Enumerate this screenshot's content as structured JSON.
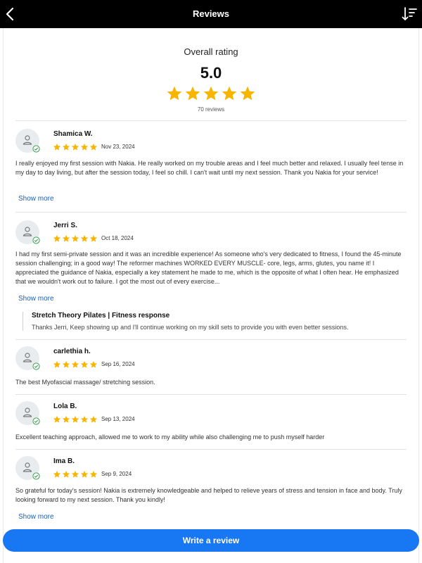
{
  "header": {
    "title": "Reviews",
    "back_icon": "chevron-left-icon",
    "sort_icon": "sort-descending-icon"
  },
  "overall": {
    "label": "Overall rating",
    "score": "5.0",
    "stars": 5,
    "count": "70 reviews"
  },
  "colors": {
    "star": "#f7b500",
    "accent": "#1877f2",
    "verified": "#2e9e44"
  },
  "reviews": [
    {
      "name": "Shamica W.",
      "rating": 5,
      "date": "Nov 23, 2024",
      "text": "I really enjoyed my first session with Nakia. He really worked on my trouble areas and I feel much better and relaxed. I usually feel tense in my day to day living, but after the session today, I feel so chill. I can't wait until my next session. Thank you Nakia for your service!",
      "more": "Show more"
    },
    {
      "name": "Jerri S.",
      "rating": 5,
      "date": "Oct 18, 2024",
      "text": "I had my first semi-private session and it was an incredible experience! As someone who's very dedicated to fitness, I found the 45-minute session challenging; in a good way! The reformer machines WORKED EVERY MUSCLE- core, legs, arms, glutes, you name it! I appreciated the guidance of Nakia, especially a key statement he made to me, which is the opposite of what I often hear. He emphasized that we wouldn't work out to failure. I got the most out of every exercise...",
      "more": "Show more",
      "response": {
        "title": "Stretch Theory Pilates | Fitness response",
        "text": "Thanks Jerri, Keep showing up and I'll continue working on my skill sets to provide you with even better sessions."
      }
    },
    {
      "name": "carlethia h.",
      "rating": 5,
      "date": "Sep 16, 2024",
      "text": "The best Myofascial massage/ stretching session."
    },
    {
      "name": "Lola B.",
      "rating": 5,
      "date": "Sep 13, 2024",
      "text": "Excellent teaching approach, allowed me to work to my ability while also challenging me to push myself harder"
    },
    {
      "name": "Ima B.",
      "rating": 5,
      "date": "Sep 9, 2024",
      "text": "So grateful for today's session! Nakia is extremely knowledgeable and helped to relieve years of stress and tension in face and body. Truly looking forward to my next session. Thank you kindly!",
      "more": "Show more"
    }
  ],
  "cta": {
    "label": "Write a review"
  }
}
